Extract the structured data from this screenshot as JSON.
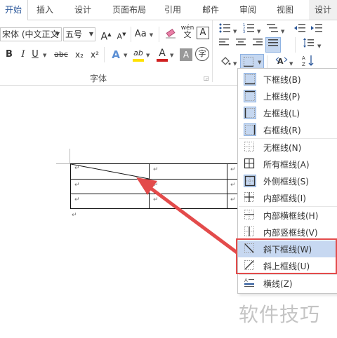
{
  "tabs": [
    {
      "label": "开始",
      "active": true
    },
    {
      "label": "插入"
    },
    {
      "label": "设计"
    },
    {
      "label": "页面布局"
    },
    {
      "label": "引用"
    },
    {
      "label": "邮件"
    },
    {
      "label": "审阅"
    },
    {
      "label": "视图"
    },
    {
      "label": "设计",
      "contextual": true
    }
  ],
  "ribbon": {
    "font_name": "宋体 (中文正文",
    "font_size": "五号",
    "grow_font": "A",
    "shrink_font": "A",
    "change_case": "Aa",
    "phonetic": "wén",
    "char_border": "A",
    "bold": "B",
    "italic": "I",
    "underline": "U",
    "strikethrough": "abc",
    "subscript": "x₂",
    "superscript": "x²",
    "text_effect": "A",
    "highlight": "ab",
    "font_color": "A",
    "char_shading": "A",
    "enclose": "字",
    "font_group_label": "字体",
    "accent_color": "#2b579a",
    "highlight_color": "#ffe100",
    "font_color_value": "#d02020"
  },
  "document": {
    "cell_mark": "↵",
    "para_mark": "↵"
  },
  "border_menu": {
    "items": [
      {
        "label": "下框线(B)",
        "icon": "bottom-border-icon",
        "selected": true
      },
      {
        "label": "上框线(P)",
        "icon": "top-border-icon",
        "selected": true
      },
      {
        "label": "左框线(L)",
        "icon": "left-border-icon",
        "selected": true
      },
      {
        "label": "右框线(R)",
        "icon": "right-border-icon",
        "selected": true
      },
      {
        "label": "无框线(N)",
        "icon": "no-border-icon"
      },
      {
        "label": "所有框线(A)",
        "icon": "all-borders-icon"
      },
      {
        "label": "外侧框线(S)",
        "icon": "outside-borders-icon"
      },
      {
        "label": "内部框线(I)",
        "icon": "inside-borders-icon"
      },
      {
        "label": "内部横框线(H)",
        "icon": "inside-horizontal-border-icon"
      },
      {
        "label": "内部竖框线(V)",
        "icon": "inside-vertical-border-icon"
      },
      {
        "label": "斜下框线(W)",
        "icon": "diagonal-down-border-icon",
        "highlighted": true
      },
      {
        "label": "斜上框线(U)",
        "icon": "diagonal-up-border-icon"
      },
      {
        "label": "横线(Z)",
        "icon": "horizontal-line-icon"
      }
    ]
  },
  "annotation": {
    "color": "#e34b4b"
  },
  "watermark": "软件技巧"
}
